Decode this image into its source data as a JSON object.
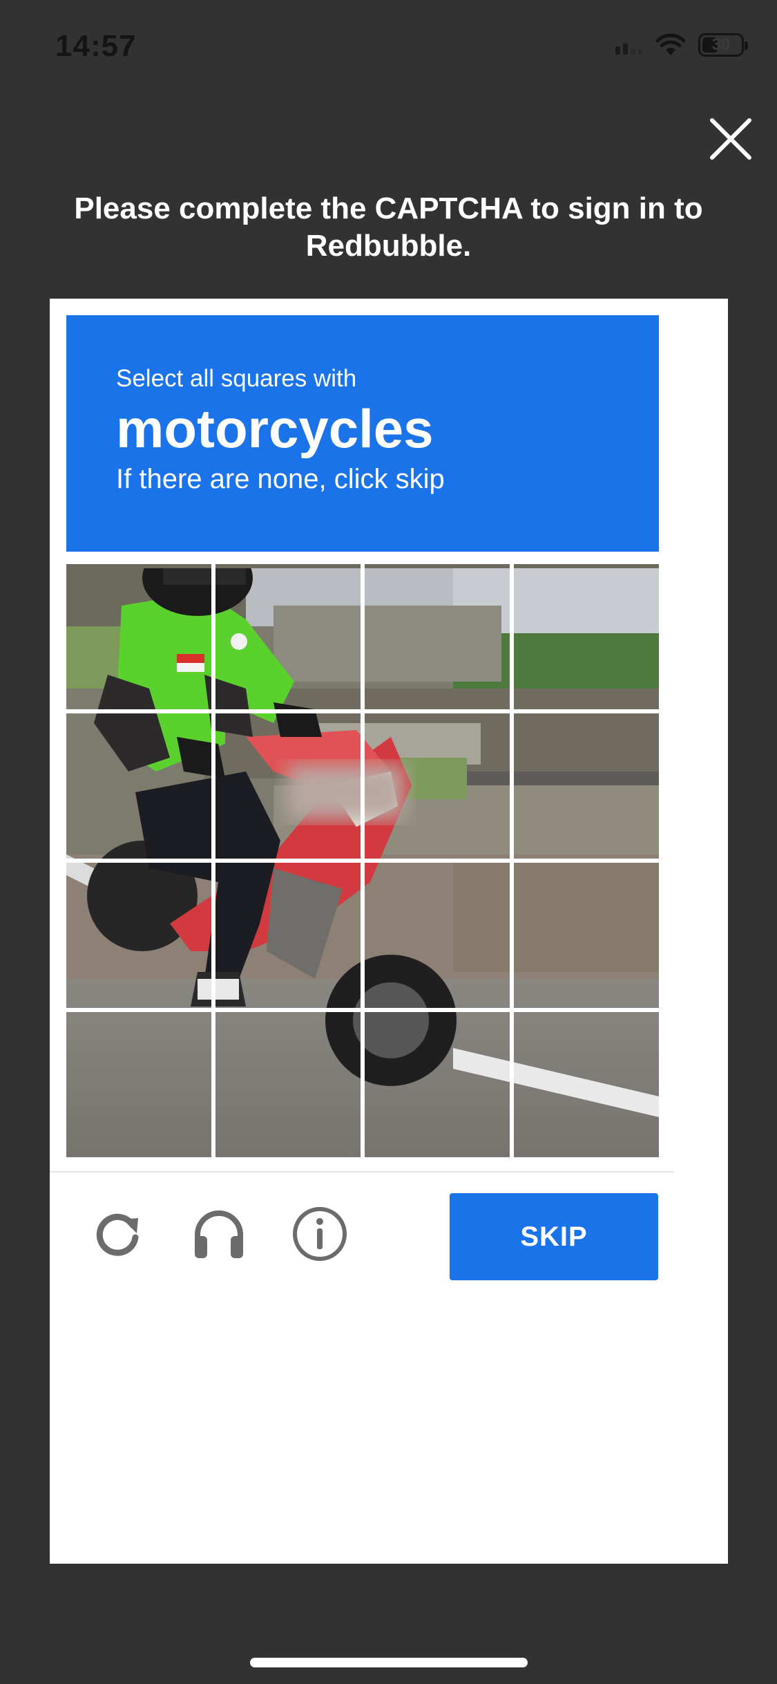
{
  "status_bar": {
    "time": "14:57",
    "battery": "30",
    "icons": [
      "signal-icon",
      "wifi-icon",
      "battery-icon"
    ]
  },
  "header": {
    "close_icon": "close-icon",
    "title": "Please complete the CAPTCHA to sign in to Redbubble."
  },
  "captcha": {
    "prompt_line1": "Select all squares with",
    "prompt_target": "motorcycles",
    "prompt_line3": "If there are none, click skip",
    "grid": {
      "rows": 4,
      "cols": 4
    },
    "tools": [
      "refresh-icon",
      "audio-headphones-icon",
      "info-icon"
    ],
    "skip_label": "SKIP"
  },
  "colors": {
    "background": "#323232",
    "accent": "#1a73e8",
    "card": "#ffffff"
  }
}
